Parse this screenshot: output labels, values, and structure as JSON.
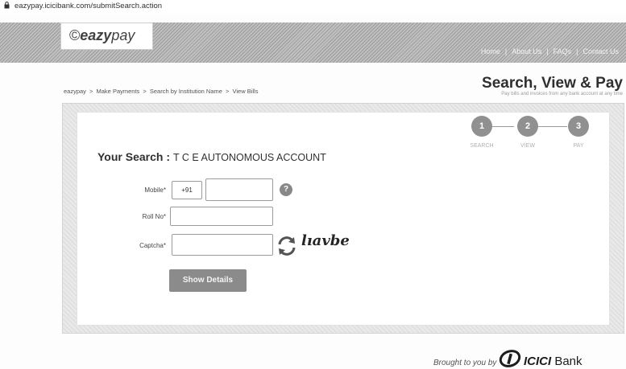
{
  "address_bar": {
    "url": "eazypay.icicibank.com/submitSearch.action",
    "icon": "lock-icon"
  },
  "header": {
    "logo_symbol": "©",
    "logo_bold": "eazy",
    "logo_light": "pay",
    "nav": [
      "Home",
      "About Us",
      "FAQs",
      "Contact Us"
    ],
    "nav_separator": "|"
  },
  "breadcrumb": {
    "items": [
      "eazypay",
      "Make Payments",
      "Search by Institution Name",
      "View Bills"
    ],
    "separator": ">"
  },
  "page": {
    "title": "Search, View & Pay",
    "subtitle": "Pay bills and invoices from any bank account at any time"
  },
  "steps": [
    {
      "number": "1",
      "label": "SEARCH"
    },
    {
      "number": "2",
      "label": "VIEW"
    },
    {
      "number": "3",
      "label": "PAY"
    }
  ],
  "search": {
    "label": "Your Search :",
    "value": "T C E AUTONOMOUS ACCOUNT"
  },
  "form": {
    "mobile_label": "Mobile*",
    "mobile_code": "+91",
    "mobile_value": "",
    "help_icon_text": "?",
    "roll_label": "Roll No*",
    "roll_value": "",
    "captcha_label": "Captcha*",
    "captcha_value": "",
    "captcha_text": "lıavbe",
    "refresh_icon": "refresh-icon",
    "submit_label": "Show Details"
  },
  "footer": {
    "brought_by": "Brought to you by",
    "bank_bold": "ICICI",
    "bank_rest": " Bank"
  }
}
